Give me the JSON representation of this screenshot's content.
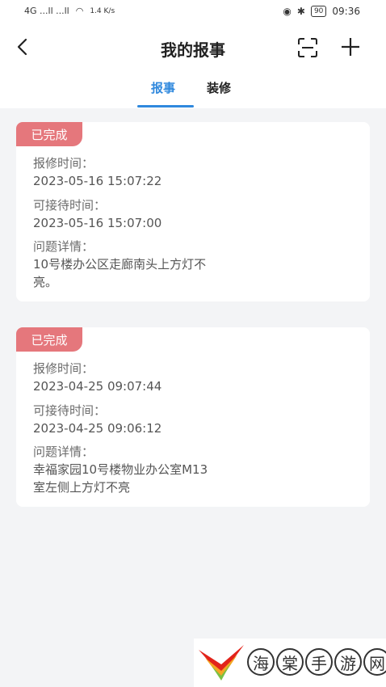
{
  "status_bar": {
    "left_text": "4G ...ll ...ll",
    "speed": "1.4 K/s",
    "battery": "90",
    "time": "09:36"
  },
  "nav": {
    "title": "我的报事"
  },
  "tabs": [
    {
      "label": "报事",
      "active": true
    },
    {
      "label": "装修",
      "active": false
    }
  ],
  "cards": [
    {
      "status": "已完成",
      "report_time_label": "报修时间：",
      "report_time": "2023-05-16 15:07:22",
      "reception_time_label": "可接待时间：",
      "reception_time": "2023-05-16 15:07:00",
      "details_label": "问题详情：",
      "details_line1": "10号楼办公区走廊南头上方灯不",
      "details_line2": "亮。"
    },
    {
      "status": "已完成",
      "report_time_label": "报修时间：",
      "report_time": "2023-04-25 09:07:44",
      "reception_time_label": "可接待时间：",
      "reception_time": "2023-04-25 09:06:12",
      "details_label": "问题详情：",
      "details_line1": "幸福家园10号楼物业办公室M13",
      "details_line2": "室左侧上方灯不亮"
    }
  ],
  "watermark": {
    "chars": [
      "海",
      "棠",
      "手",
      "游",
      "网"
    ]
  },
  "colors": {
    "accent": "#2f88dd",
    "badge": "#e5777c",
    "background": "#f3f4f6"
  }
}
